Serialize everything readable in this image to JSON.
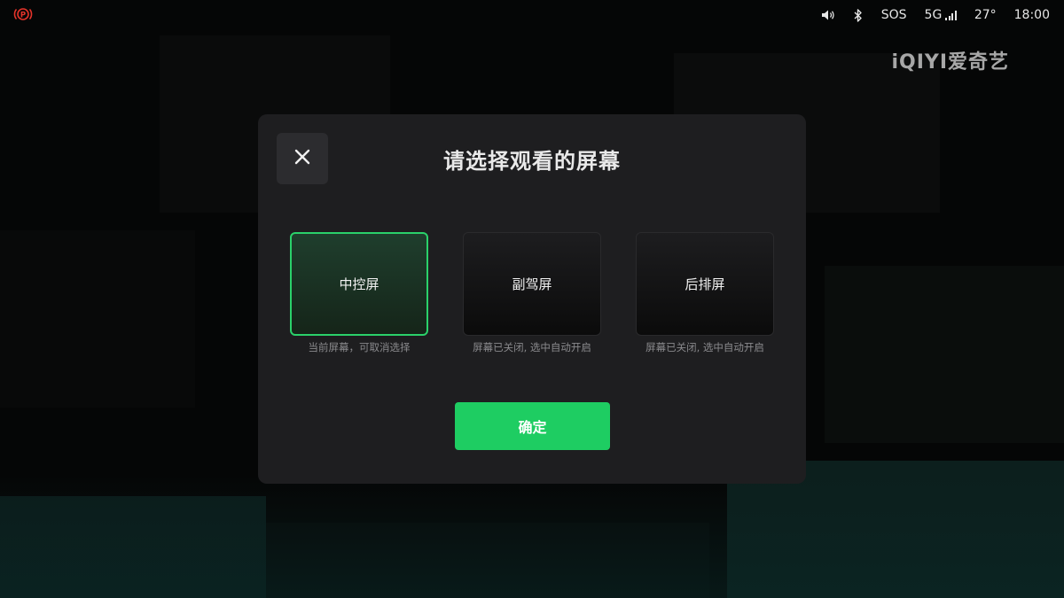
{
  "status_bar": {
    "parking_icon": "parking-brake-icon",
    "volume_icon": "volume-icon",
    "bluetooth_icon": "bluetooth-icon",
    "sos": "SOS",
    "network": "5G",
    "temperature": "27°",
    "time": "18:00"
  },
  "brand": {
    "logo_text": "iQIYI爱奇艺"
  },
  "dialog": {
    "title": "请选择观看的屏幕",
    "close_icon": "close-icon",
    "options": [
      {
        "label": "中控屏",
        "hint": "当前屏幕，可取消选择",
        "selected": true
      },
      {
        "label": "副驾屏",
        "hint": "屏幕已关闭, 选中自动开启",
        "selected": false
      },
      {
        "label": "后排屏",
        "hint": "屏幕已关闭, 选中自动开启",
        "selected": false
      }
    ],
    "confirm_label": "确定"
  },
  "colors": {
    "accent": "#1ecd62",
    "selected_border": "#2ad16a",
    "modal_bg": "#1e1e20",
    "parking_red": "#e5332a"
  }
}
